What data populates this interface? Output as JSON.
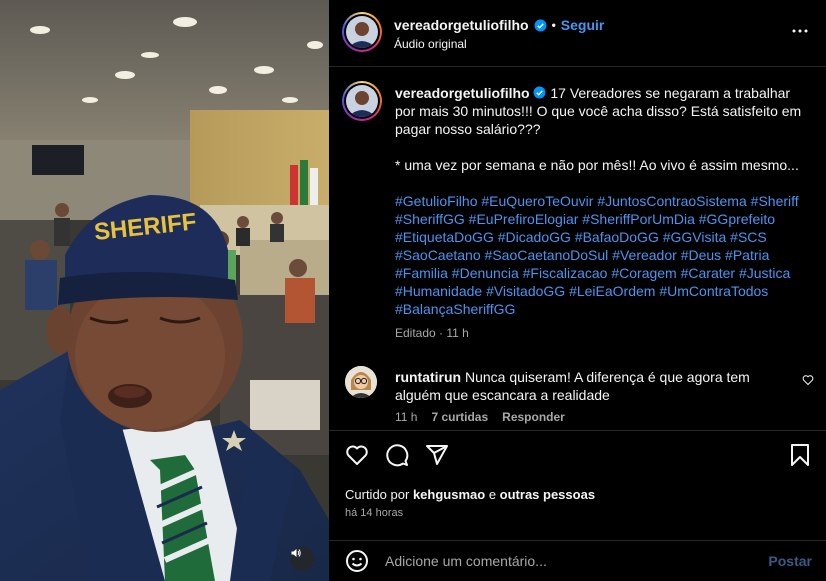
{
  "post": {
    "username": "vereadorgetuliofilho",
    "follow_label": "Seguir",
    "audio": "Áudio original",
    "dot": "•",
    "caption_lines": [
      "17 Vereadores se negaram a trabalhar por mais 30 minutos!!! O que você acha disso? Está satisfeito em pagar nosso salário???",
      "* uma vez por semana e não por mês!! Ao vivo é assim mesmo..."
    ],
    "hashtags": [
      "#GetulioFilho",
      "#EuQueroTeOuvir",
      "#JuntosContraoSistema",
      "#Sheriff",
      "#SheriffGG",
      "#EuPrefiroElogiar",
      "#SheriffPorUmDia",
      "#GGprefeito",
      "#EtiquetaDoGG",
      "#DicadoGG",
      "#BafaoDoGG",
      "#GGVisita",
      "#SCS",
      "#SaoCaetano",
      "#SaoCaetanoDoSul",
      "#Vereador",
      "#Deus",
      "#Patria",
      "#Familia",
      "#Denuncia",
      "#Fiscalizacao",
      "#Coragem",
      "#Carater",
      "#Justica",
      "#Humanidade",
      "#VisitadoGG",
      "#LeiEaOrdem",
      "#UmContraTodos",
      "#BalançaSheriffGG"
    ],
    "edited_label": "Editado",
    "edited_sep": "·",
    "edited_time": "11 h",
    "cap_text": "SHERIFF"
  },
  "comment": {
    "username": "runtatirun",
    "text": "Nunca quiseram! A diferença é que agora tem alguém que escancara a realidade",
    "time": "11 h",
    "likes": "7 curtidas",
    "reply_label": "Responder"
  },
  "likes": {
    "prefix": "Curtido por",
    "user": "kehgusmao",
    "middle": "e",
    "others": "outras pessoas",
    "time_ago": "há 14 horas"
  },
  "composer": {
    "placeholder": "Adicione um comentário...",
    "post_label": "Postar"
  },
  "icons": {
    "verified": "verified-badge-icon",
    "more": "more-options-icon",
    "like": "heart-icon",
    "comment": "comment-icon",
    "share": "share-icon",
    "save": "bookmark-icon",
    "emoji": "emoji-icon",
    "mute": "speaker-icon"
  },
  "colors": {
    "link": "#4a94f0",
    "muted": "#a8a8a8",
    "background": "#000000"
  }
}
